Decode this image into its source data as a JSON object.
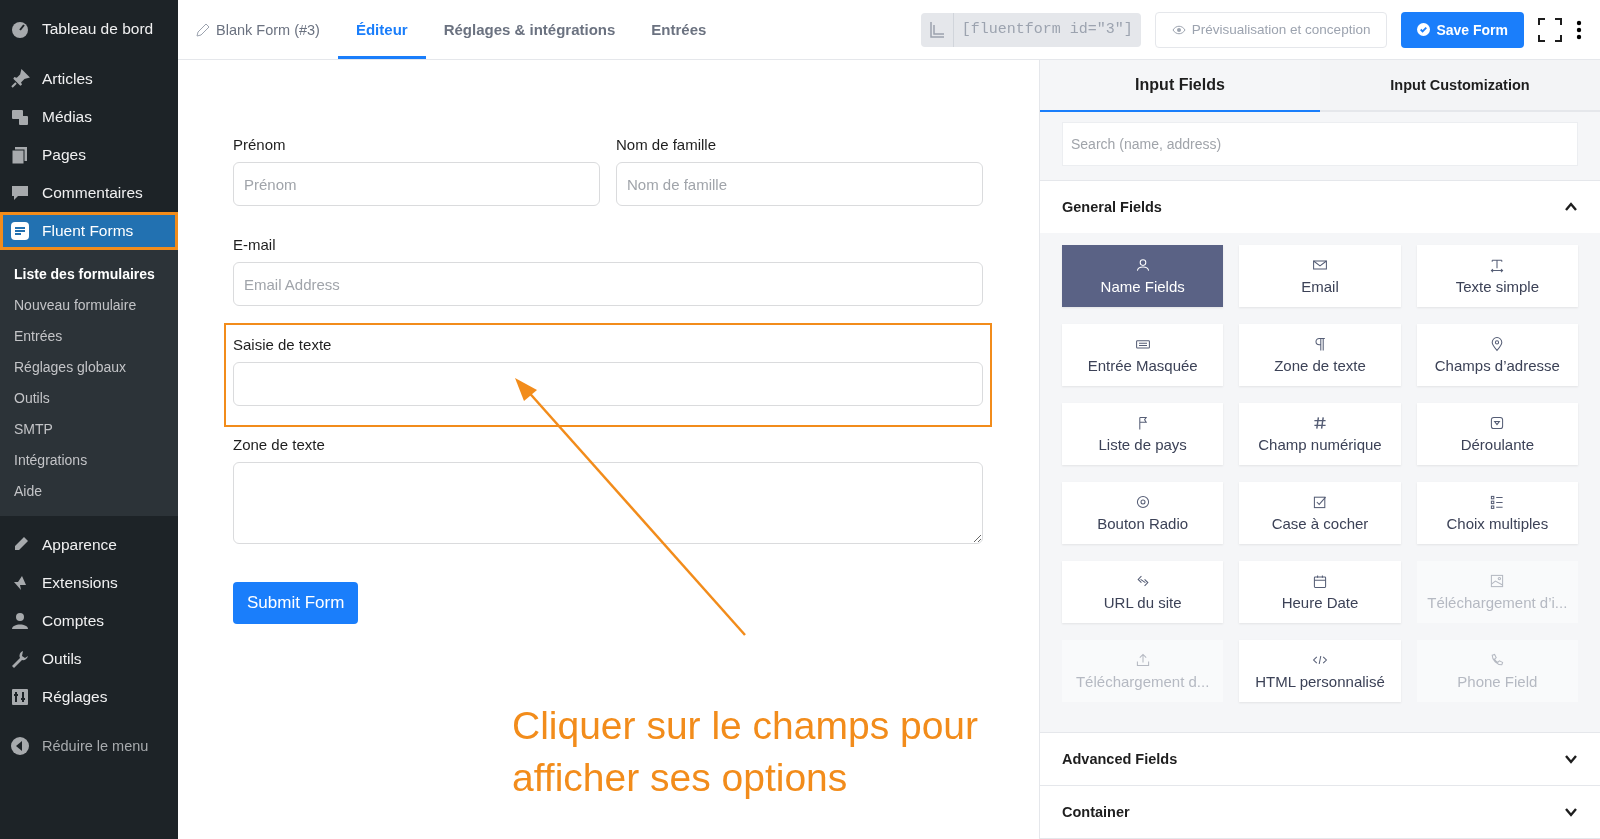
{
  "sidebar": {
    "items": [
      {
        "label": "Tableau de bord",
        "selected": false
      },
      {
        "label": "Articles",
        "selected": false
      },
      {
        "label": "Médias",
        "selected": false
      },
      {
        "label": "Pages",
        "selected": false
      },
      {
        "label": "Commentaires",
        "selected": false
      },
      {
        "label": "Fluent Forms",
        "selected": true,
        "highlighted": true,
        "children": [
          {
            "label": "Liste des formulaires",
            "selected": true
          },
          {
            "label": "Nouveau formulaire",
            "selected": false
          },
          {
            "label": "Entrées",
            "selected": false
          },
          {
            "label": "Réglages globaux",
            "selected": false
          },
          {
            "label": "Outils",
            "selected": false
          },
          {
            "label": "SMTP",
            "selected": false
          },
          {
            "label": "Intégrations",
            "selected": false
          },
          {
            "label": "Aide",
            "selected": false
          }
        ]
      },
      {
        "label": "Apparence",
        "selected": false
      },
      {
        "label": "Extensions",
        "selected": false
      },
      {
        "label": "Comptes",
        "selected": false
      },
      {
        "label": "Outils",
        "selected": false
      },
      {
        "label": "Réglages",
        "selected": false
      }
    ],
    "collapse": "Réduire le menu"
  },
  "topbar": {
    "form_title": "Blank Form (#3)",
    "tabs": [
      {
        "label": "Éditeur",
        "selected": true
      },
      {
        "label": "Réglages & intégrations",
        "selected": false
      },
      {
        "label": "Entrées",
        "selected": false
      }
    ],
    "shortcode": "[fluentform id=\"3\"]",
    "preview": "Prévisualisation et conception",
    "save": "Save Form"
  },
  "form": {
    "rows": [
      [
        {
          "kind": "input",
          "label": "Prénom",
          "placeholder": "Prénom",
          "highlighted": false
        },
        {
          "kind": "input",
          "label": "Nom de famille",
          "placeholder": "Nom de famille",
          "highlighted": false
        }
      ],
      [
        {
          "kind": "input",
          "label": "E-mail",
          "placeholder": "Email Address",
          "highlighted": false
        }
      ],
      [
        {
          "kind": "input",
          "label": "Saisie de texte",
          "highlighted": true
        }
      ],
      [
        {
          "kind": "textarea",
          "label": "Zone de texte",
          "highlighted": false
        }
      ]
    ],
    "submit": "Submit Form"
  },
  "annotation": {
    "text": "Cliquer sur le champs pour afficher ses options"
  },
  "panel": {
    "tabs": [
      {
        "label": "Input Fields",
        "selected": true
      },
      {
        "label": "Input Customization",
        "selected": false
      }
    ],
    "search": {
      "placeholder": "Search (name, address)"
    },
    "sections": [
      {
        "title": "General Fields",
        "expanded": true,
        "fields": [
          {
            "label": "Name Fields",
            "selected": true,
            "disabled": false
          },
          {
            "label": "Email",
            "selected": false,
            "disabled": false
          },
          {
            "label": "Texte simple",
            "selected": false,
            "disabled": false
          },
          {
            "label": "Entrée Masquée",
            "selected": false,
            "disabled": false
          },
          {
            "label": "Zone de texte",
            "selected": false,
            "disabled": false
          },
          {
            "label": "Champs d’adresse",
            "selected": false,
            "disabled": false
          },
          {
            "label": "Liste de pays",
            "selected": false,
            "disabled": false
          },
          {
            "label": "Champ numérique",
            "selected": false,
            "disabled": false
          },
          {
            "label": "Déroulante",
            "selected": false,
            "disabled": false
          },
          {
            "label": "Bouton Radio",
            "selected": false,
            "disabled": false
          },
          {
            "label": "Case à cocher",
            "selected": false,
            "disabled": false
          },
          {
            "label": "Choix multiples",
            "selected": false,
            "disabled": false
          },
          {
            "label": "URL du site",
            "selected": false,
            "disabled": false
          },
          {
            "label": "Heure Date",
            "selected": false,
            "disabled": false
          },
          {
            "label": "Téléchargement d’i...",
            "selected": false,
            "disabled": true
          },
          {
            "label": "Téléchargement d...",
            "selected": false,
            "disabled": true
          },
          {
            "label": "HTML personnalisé",
            "selected": false,
            "disabled": false
          },
          {
            "label": "Phone Field",
            "selected": false,
            "disabled": true
          }
        ]
      },
      {
        "title": "Advanced Fields",
        "expanded": false
      },
      {
        "title": "Container",
        "expanded": false
      }
    ]
  }
}
